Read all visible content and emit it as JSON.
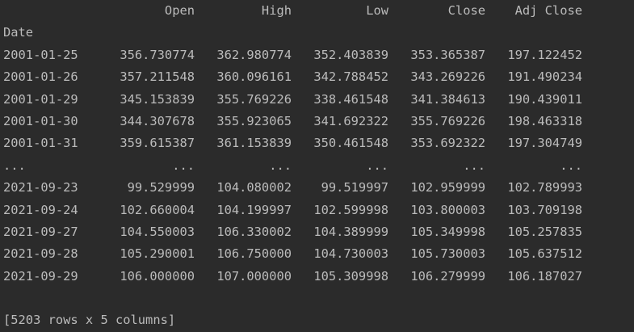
{
  "table": {
    "columns": [
      "Open",
      "High",
      "Low",
      "Close",
      "Adj Close"
    ],
    "index_name": "Date",
    "rows": [
      {
        "date": "2001-01-25",
        "values": [
          "356.730774",
          "362.980774",
          "352.403839",
          "353.365387",
          "197.122452"
        ]
      },
      {
        "date": "2001-01-26",
        "values": [
          "357.211548",
          "360.096161",
          "342.788452",
          "343.269226",
          "191.490234"
        ]
      },
      {
        "date": "2001-01-29",
        "values": [
          "345.153839",
          "355.769226",
          "338.461548",
          "341.384613",
          "190.439011"
        ]
      },
      {
        "date": "2001-01-30",
        "values": [
          "344.307678",
          "355.923065",
          "341.692322",
          "355.769226",
          "198.463318"
        ]
      },
      {
        "date": "2001-01-31",
        "values": [
          "359.615387",
          "361.153839",
          "350.461548",
          "353.692322",
          "197.304749"
        ]
      },
      {
        "date": "...",
        "values": [
          "...",
          "...",
          "...",
          "...",
          "..."
        ]
      },
      {
        "date": "2021-09-23",
        "values": [
          "99.529999",
          "104.080002",
          "99.519997",
          "102.959999",
          "102.789993"
        ]
      },
      {
        "date": "2021-09-24",
        "values": [
          "102.660004",
          "104.199997",
          "102.599998",
          "103.800003",
          "103.709198"
        ]
      },
      {
        "date": "2021-09-27",
        "values": [
          "104.550003",
          "106.330002",
          "104.389999",
          "105.349998",
          "105.257835"
        ]
      },
      {
        "date": "2021-09-28",
        "values": [
          "105.290001",
          "106.750000",
          "104.730003",
          "105.730003",
          "105.637512"
        ]
      },
      {
        "date": "2021-09-29",
        "values": [
          "106.000000",
          "107.000000",
          "105.309998",
          "106.279999",
          "106.187027"
        ]
      }
    ],
    "summary": "[5203 rows x 5 columns]"
  }
}
